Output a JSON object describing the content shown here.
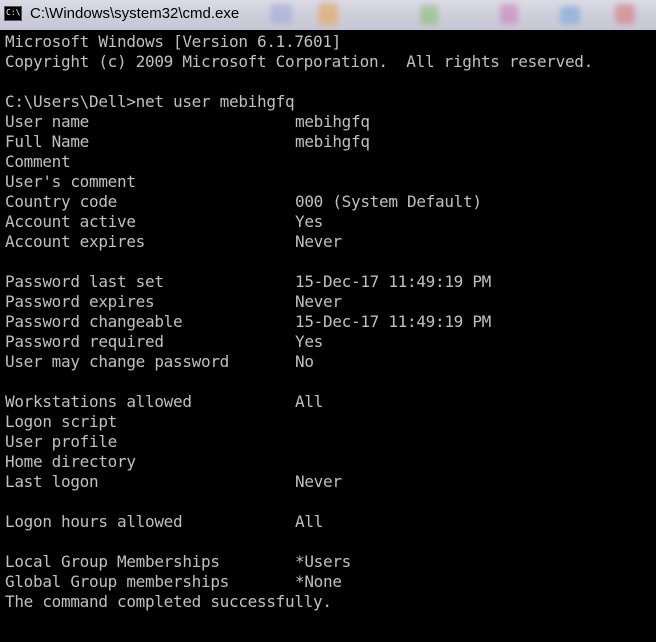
{
  "window": {
    "title": "C:\\Windows\\system32\\cmd.exe",
    "icon": "cmd-prompt-icon",
    "icon_text": "C:\\."
  },
  "colors": {
    "console_bg": "#000000",
    "console_fg": "#c0c0c0"
  },
  "console": {
    "header": [
      "Microsoft Windows [Version 6.1.7601]",
      "Copyright (c) 2009 Microsoft Corporation.  All rights reserved."
    ],
    "prompt": "C:\\Users\\Dell>net user mebihgfq",
    "fields": [
      {
        "key": "User name",
        "value": "mebihgfq"
      },
      {
        "key": "Full Name",
        "value": "mebihgfq"
      },
      {
        "key": "Comment",
        "value": ""
      },
      {
        "key": "User's comment",
        "value": ""
      },
      {
        "key": "Country code",
        "value": "000 (System Default)"
      },
      {
        "key": "Account active",
        "value": "Yes"
      },
      {
        "key": "Account expires",
        "value": "Never"
      },
      {
        "key": "Password last set",
        "value": "15-Dec-17 11:49:19 PM"
      },
      {
        "key": "Password expires",
        "value": "Never"
      },
      {
        "key": "Password changeable",
        "value": "15-Dec-17 11:49:19 PM"
      },
      {
        "key": "Password required",
        "value": "Yes"
      },
      {
        "key": "User may change password",
        "value": "No"
      },
      {
        "key": "Workstations allowed",
        "value": "All"
      },
      {
        "key": "Logon script",
        "value": ""
      },
      {
        "key": "User profile",
        "value": ""
      },
      {
        "key": "Home directory",
        "value": ""
      },
      {
        "key": "Last logon",
        "value": "Never"
      },
      {
        "key": "Logon hours allowed",
        "value": "All"
      },
      {
        "key": "Local Group Memberships",
        "value": "*Users"
      },
      {
        "key": "Global Group memberships",
        "value": "*None"
      }
    ],
    "completion": "The command completed successfully."
  }
}
